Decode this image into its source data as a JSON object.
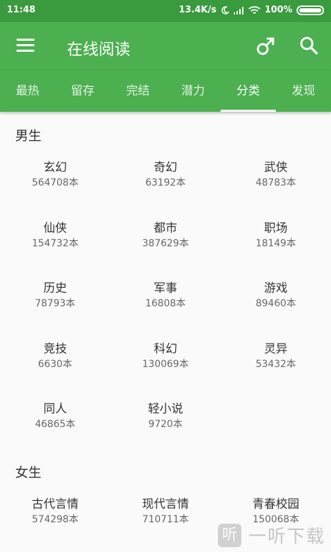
{
  "status_bar": {
    "time": "11:48",
    "speed": "13.4K/s",
    "battery": "100%"
  },
  "app_bar": {
    "title": "在线阅读"
  },
  "tabs": [
    {
      "label": "最热"
    },
    {
      "label": "留存"
    },
    {
      "label": "完结"
    },
    {
      "label": "潜力"
    },
    {
      "label": "分类"
    },
    {
      "label": "发现"
    }
  ],
  "active_tab": "分类",
  "sections": [
    {
      "title": "男生",
      "items": [
        {
          "name": "玄幻",
          "count": "564708本"
        },
        {
          "name": "奇幻",
          "count": "63192本"
        },
        {
          "name": "武侠",
          "count": "48783本"
        },
        {
          "name": "仙侠",
          "count": "154732本"
        },
        {
          "name": "都市",
          "count": "387629本"
        },
        {
          "name": "职场",
          "count": "18149本"
        },
        {
          "name": "历史",
          "count": "78793本"
        },
        {
          "name": "军事",
          "count": "16808本"
        },
        {
          "name": "游戏",
          "count": "89460本"
        },
        {
          "name": "竞技",
          "count": "6630本"
        },
        {
          "name": "科幻",
          "count": "130069本"
        },
        {
          "name": "灵异",
          "count": "53432本"
        },
        {
          "name": "同人",
          "count": "46865本"
        },
        {
          "name": "轻小说",
          "count": "9720本"
        }
      ]
    },
    {
      "title": "女生",
      "items": [
        {
          "name": "古代言情",
          "count": "574298本"
        },
        {
          "name": "现代言情",
          "count": "710711本"
        },
        {
          "name": "青春校园",
          "count": "150068本"
        }
      ]
    }
  ],
  "watermark": {
    "icon": "听",
    "text": "一听下载"
  },
  "colors": {
    "primary": "#4caf50",
    "status_bar": "#3a9a3e"
  }
}
